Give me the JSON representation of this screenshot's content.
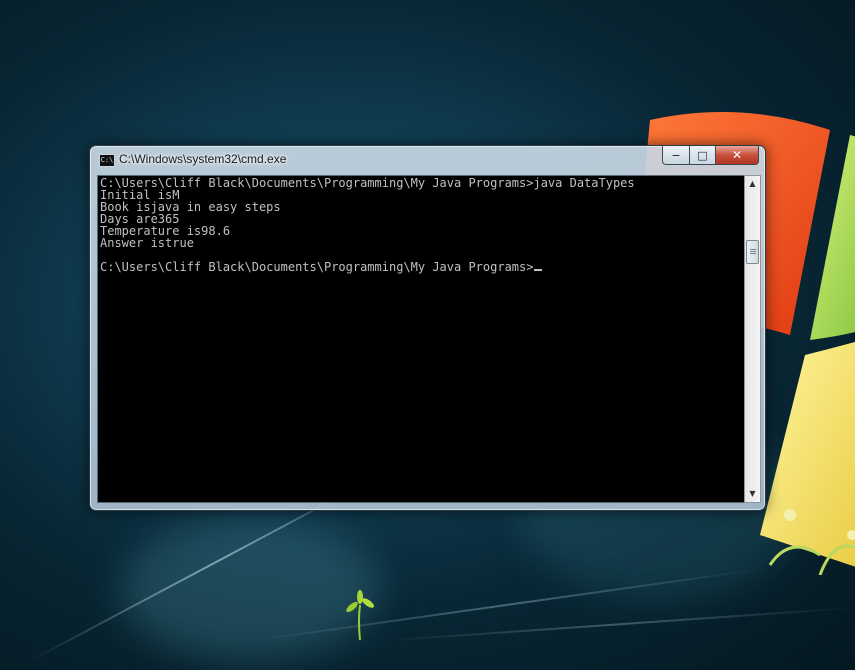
{
  "window": {
    "title": "C:\\Windows\\system32\\cmd.exe",
    "icon_text": "C:\\",
    "controls": {
      "minimize": "−",
      "maximize": "□",
      "close": "✕"
    }
  },
  "console": {
    "lines": [
      "C:\\Users\\Cliff Black\\Documents\\Programming\\My Java Programs>java DataTypes",
      "Initial isM",
      "Book isjava in easy steps",
      "Days are365",
      "Temperature is98.6",
      "Answer istrue",
      "",
      "C:\\Users\\Cliff Black\\Documents\\Programming\\My Java Programs>"
    ]
  },
  "scrollbar": {
    "up_arrow": "▲",
    "down_arrow": "▼"
  },
  "colors": {
    "console_bg": "#000000",
    "console_text": "#c0c0c0",
    "close_button": "#c8503c"
  }
}
